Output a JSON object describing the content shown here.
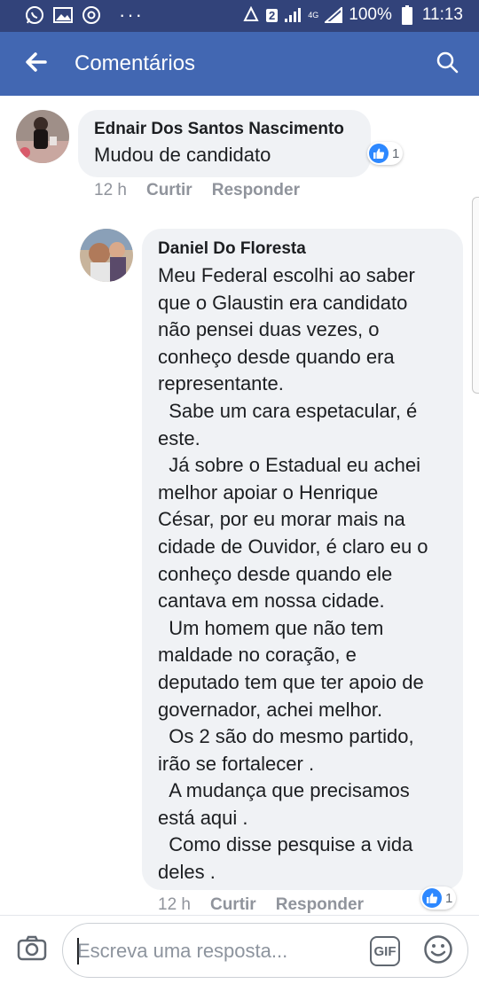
{
  "status_bar": {
    "battery": "100%",
    "time": "11:13",
    "notification_count": "2",
    "network": "4G",
    "dots": "···"
  },
  "app_bar": {
    "title": "Comentários"
  },
  "comments": [
    {
      "author": "Ednair Dos Santos Nascimento",
      "text": "Mudou de candidato",
      "time": "12 h",
      "like_label": "Curtir",
      "reply_label": "Responder",
      "reaction_count": "1"
    },
    {
      "author": "Daniel Do Floresta",
      "text": "Meu Federal escolhi ao saber\nque o Glaustin era candidato\nnão pensei duas vezes, o\nconheço desde quando era\nrepresentante.\n  Sabe um cara espetacular, é\neste.\n  Já sobre o Estadual eu achei\nmelhor apoiar o Henrique\nCésar, por eu morar mais na\ncidade de Ouvidor, é claro eu o\nconheço desde quando ele\ncantava em nossa cidade.\n  Um homem que não tem\nmaldade no coração, e\ndeputado tem que ter apoio de\ngovernador, achei melhor.\n  Os 2 são do mesmo partido,\nirão se fortalecer .\n  A mudança que precisamos\nestá aqui .\n  Como disse pesquise a vida\ndeles .",
      "time": "12 h",
      "like_label": "Curtir",
      "reply_label": "Responder",
      "reaction_count": "1"
    }
  ],
  "composer": {
    "placeholder": "Escreva uma resposta...",
    "gif_label": "GIF"
  },
  "colors": {
    "status_bar": "#32437a",
    "app_bar": "#4267b2",
    "bubble": "#f0f2f5",
    "like_blue": "#2d88ff"
  }
}
